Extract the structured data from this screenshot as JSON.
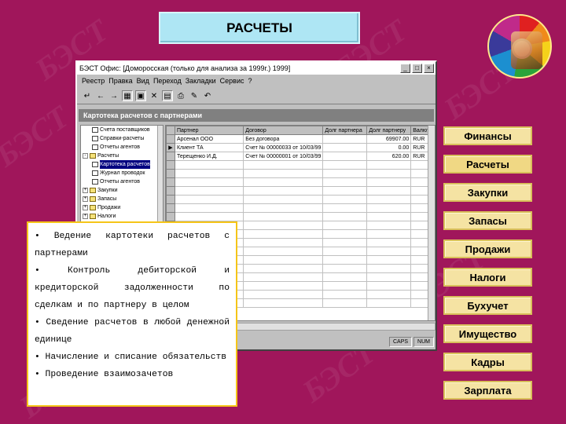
{
  "slide": {
    "title": "РАСЧЕТЫ",
    "watermark": "БЭСТ",
    "accent_colors": {
      "background": "#a0165b",
      "button": "#f5e3a3",
      "title_box": "#aee6f4",
      "panel_border": "#f5c518"
    }
  },
  "app": {
    "window_title": "БЭСТ Офис: [Доморосская (только для анализа за 1999г.) 1999]",
    "window_buttons": [
      "_",
      "□",
      "×"
    ],
    "menu": [
      "Реестр",
      "Правка",
      "Вид",
      "Переход",
      "Закладки",
      "Сервис",
      "?"
    ],
    "toolbar_icons": [
      "enter-icon",
      "back-icon",
      "forward-icon",
      "grid-icon",
      "open-icon",
      "close-icon",
      "filter-icon",
      "print-icon",
      "edit-icon",
      "undo-icon"
    ],
    "section_title": "Картотека расчетов с партнерами",
    "tree": [
      {
        "label": "Счета поставщиков",
        "kind": "doc"
      },
      {
        "label": "Справки-расчеты",
        "kind": "doc"
      },
      {
        "label": "Отчеты агентов",
        "kind": "doc"
      },
      {
        "label": "Расчеты",
        "kind": "folder",
        "toggle": "-"
      },
      {
        "label": "Картотека расчетов",
        "kind": "doc",
        "selected": true
      },
      {
        "label": "Журнал проводок",
        "kind": "doc"
      },
      {
        "label": "Отчеты агентов",
        "kind": "doc"
      },
      {
        "label": "Закупки",
        "kind": "folder",
        "toggle": "+"
      },
      {
        "label": "Запасы",
        "kind": "folder",
        "toggle": "+"
      },
      {
        "label": "Продажи",
        "kind": "folder",
        "toggle": "+"
      },
      {
        "label": "Налоги",
        "kind": "folder",
        "toggle": "+"
      }
    ],
    "grid": {
      "columns": [
        "Партнер",
        "Договор",
        "Долг партнера",
        "Долг партнеру",
        "Валюта"
      ],
      "rows": [
        [
          "Арсенал ООО",
          "Без договора",
          "",
          "69907.00",
          "RUR"
        ],
        [
          "Клиент ТА",
          "Счет № 00000033 от 10/03/99",
          "",
          "0.00",
          "RUR"
        ],
        [
          "Терещенко И.Д.",
          "Счет № 00000001 от 10/03/99",
          "",
          "620.00",
          "RUR"
        ]
      ],
      "current_row": 1
    },
    "status": [
      "CAPS",
      "NUM"
    ]
  },
  "info_panel": {
    "bullets": [
      "• Ведение картотеки расчетов с партнерами",
      "• Контроль дебиторской и кредиторской задолженности по сделкам и по партнеру в целом",
      "• Сведение расчетов в любой денежной единице",
      "• Начисление и списание обязательств",
      "• Проведение взаимозачетов"
    ]
  },
  "nav_menu": {
    "items": [
      "Финансы",
      "Расчеты",
      "Закупки",
      "Запасы",
      "Продажи",
      "Налоги",
      "Бухучет",
      "Имущество",
      "Кадры",
      "Зарплата"
    ],
    "active": "Расчеты"
  }
}
